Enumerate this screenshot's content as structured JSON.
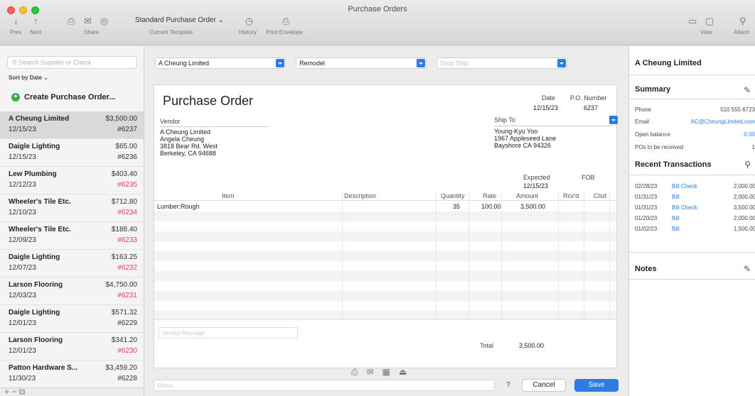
{
  "window": {
    "title": "Purchase Orders"
  },
  "toolbar": {
    "prev": "Prev",
    "next": "Next",
    "share": "Share",
    "template_value": "Standard Purchase Order",
    "template_label": "Current Template",
    "history": "History",
    "print_envelope": "Print Envelope",
    "view": "View",
    "attach": "Attach"
  },
  "list": {
    "search_placeholder": "Search Supplier or Check",
    "sort_label": "Sort by Date",
    "create_label": "Create Purchase Order...",
    "items": [
      {
        "name": "A Cheung Limited",
        "amount": "$3,500.00",
        "date": "12/15/23",
        "number": "#6237",
        "open": false
      },
      {
        "name": "Daigle Lighting",
        "amount": "$65.00",
        "date": "12/15/23",
        "number": "#6236",
        "open": false
      },
      {
        "name": "Lew Plumbing",
        "amount": "$403.40",
        "date": "12/12/23",
        "number": "#6235",
        "open": true
      },
      {
        "name": "Wheeler's Tile Etc.",
        "amount": "$712.80",
        "date": "12/10/23",
        "number": "#6234",
        "open": true
      },
      {
        "name": "Wheeler's Tile Etc.",
        "amount": "$188.40",
        "date": "12/09/23",
        "number": "#6233",
        "open": true
      },
      {
        "name": "Daigle Lighting",
        "amount": "$163.25",
        "date": "12/07/23",
        "number": "#6232",
        "open": true
      },
      {
        "name": "Larson Flooring",
        "amount": "$4,750.00",
        "date": "12/03/23",
        "number": "#6231",
        "open": true
      },
      {
        "name": "Daigle Lighting",
        "amount": "$571.32",
        "date": "12/01/23",
        "number": "#6229",
        "open": false
      },
      {
        "name": "Larson Flooring",
        "amount": "$341.20",
        "date": "12/01/23",
        "number": "#6230",
        "open": true
      },
      {
        "name": "Patton Hardware S...",
        "amount": "$3,459.20",
        "date": "11/30/23",
        "number": "#6228",
        "open": false
      }
    ]
  },
  "form": {
    "vendor_combo": "A Cheung Limited",
    "class_combo": "Remodel",
    "third_combo_placeholder": "Drop Ship",
    "title": "Purchase Order",
    "date_label": "Date",
    "date_value": "12/15/23",
    "po_label": "P.O. Number",
    "po_value": "6237",
    "vendor_label": "Vendor",
    "vendor_address": [
      "A Cheung Limited",
      "Angela Cheung",
      "3818 Bear Rd. West",
      "Berkeley, CA 94688"
    ],
    "shipto_label": "Ship To",
    "shipto_address": [
      "Young-Kyu Yoo",
      "1967 Appleseed Lane",
      "Bayshore CA 94326"
    ],
    "expected_label": "Expected",
    "expected_value": "12/15/23",
    "fob_label": "FOB",
    "columns": {
      "item": "Item",
      "description": "Description",
      "quantity": "Quantity",
      "rate": "Rate",
      "amount": "Amount",
      "rcvd": "Rcv'd",
      "clsd": "Clsd"
    },
    "lines": [
      {
        "item": "Lumber:Rough",
        "description": "",
        "quantity": "35",
        "rate": "100.00",
        "amount": "3,500.00"
      }
    ],
    "vendor_message_placeholder": "Vendor Message",
    "total_label": "Total",
    "total_value": "3,500.00",
    "memo_placeholder": "Memo",
    "help": "?",
    "cancel": "Cancel",
    "save": "Save"
  },
  "panel": {
    "title": "A Cheung Limited",
    "summary_label": "Summary",
    "phone_label": "Phone",
    "phone_value": "510 555 6723",
    "email_label": "Email",
    "email_value": "AC@CheungLimited.com",
    "balance_label": "Open balance",
    "balance_value": "0.00",
    "pos_label": "POs to be received",
    "pos_value": "1",
    "recent_label": "Recent Transactions",
    "transactions": [
      {
        "date": "02/28/23",
        "type": "Bill Check",
        "amount": "2,000.00"
      },
      {
        "date": "01/31/23",
        "type": "Bill",
        "amount": "2,000.00"
      },
      {
        "date": "01/31/23",
        "type": "Bill Check",
        "amount": "3,500.00"
      },
      {
        "date": "01/20/23",
        "type": "Bill",
        "amount": "2,000.00"
      },
      {
        "date": "01/02/23",
        "type": "Bill",
        "amount": "1,500.00"
      }
    ],
    "notes_label": "Notes"
  }
}
